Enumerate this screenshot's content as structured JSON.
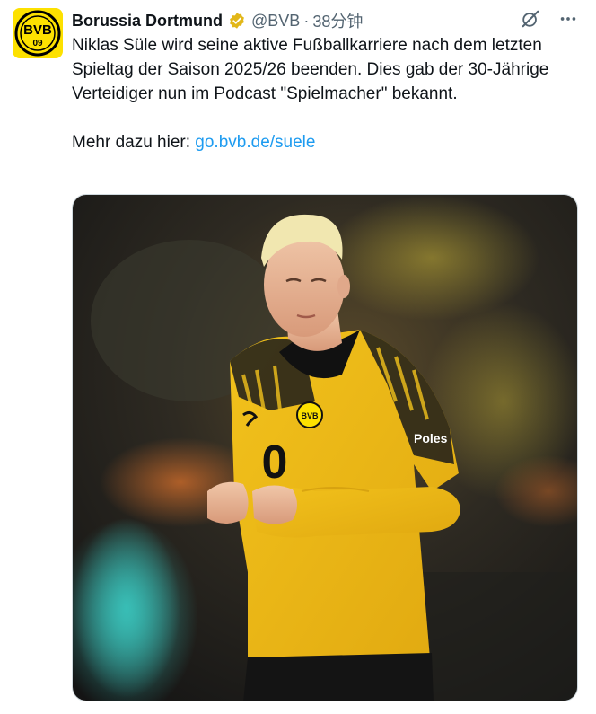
{
  "author": {
    "name": "Borussia Dortmund",
    "handle": "@BVB",
    "separator": "·",
    "time": "38分钟",
    "avatar_text_top": "BVB",
    "avatar_text_bottom": "09"
  },
  "tweet": {
    "text_line1": "Niklas Süle wird seine aktive Fußballkarriere nach dem letzten Spieltag der Saison 2025/26 beenden. Dies gab der 30-Jährige Verteidiger nun im Podcast \"Spielmacher\" bekannt.",
    "more_prefix": "Mehr dazu hier: ",
    "link_text": "go.bvb.de/suele"
  },
  "media": {
    "jersey_number": "0",
    "crest_text": "BVB",
    "sponsor_text": "Poles"
  },
  "colors": {
    "accent_link": "#1d9bf0",
    "bvb_yellow": "#fde100",
    "verified_gold": "#e2b719"
  },
  "icons": {
    "verified": "verified-badge-icon",
    "grok": "grok-icon",
    "more": "more-icon"
  }
}
